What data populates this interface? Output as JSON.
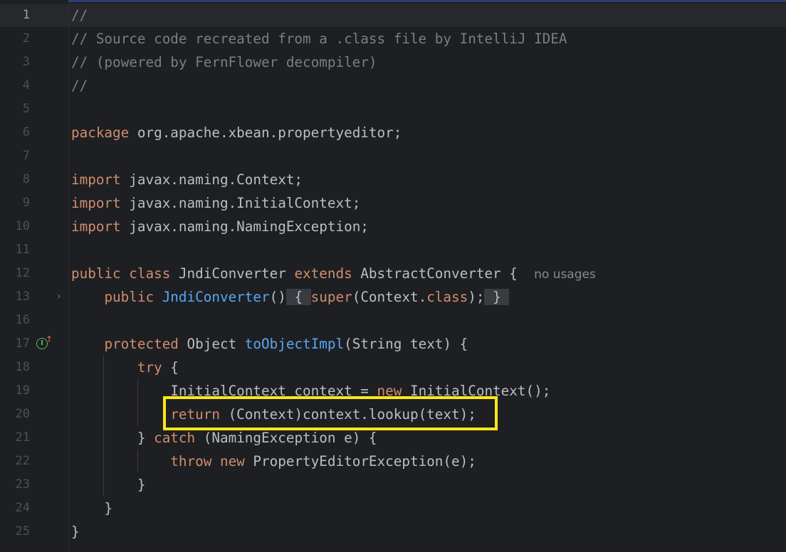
{
  "editor": {
    "lines": [
      {
        "num": "1",
        "text": "//"
      },
      {
        "num": "2",
        "text": "// Source code recreated from a .class file by IntelliJ IDEA"
      },
      {
        "num": "3",
        "text": "// (powered by FernFlower decompiler)"
      },
      {
        "num": "4",
        "text": "//"
      },
      {
        "num": "5",
        "text": ""
      },
      {
        "num": "6",
        "kw": "package",
        "rest": " org.apache.xbean.propertyeditor;"
      },
      {
        "num": "7",
        "text": ""
      },
      {
        "num": "8",
        "kw": "import",
        "rest": " javax.naming.Context;"
      },
      {
        "num": "9",
        "kw": "import",
        "rest": " javax.naming.InitialContext;"
      },
      {
        "num": "10",
        "kw": "import",
        "rest": " javax.naming.NamingException;"
      },
      {
        "num": "11",
        "text": ""
      },
      {
        "num": "12",
        "kw1": "public",
        "kw2": "class",
        "name": " JndiConverter ",
        "kw3": "extends",
        "rest": " AbstractConverter {",
        "hint": "no usages"
      },
      {
        "num": "13",
        "kw": "public",
        "fn": "JndiConverter",
        "parens": "()",
        "brace_open": "{",
        "kw_super": "super",
        "args": "(Context.",
        "kw_class": "class",
        "end": ");",
        "brace_close": "}"
      },
      {
        "num": "16",
        "text": ""
      },
      {
        "num": "17",
        "kw": "protected",
        "type": " Object ",
        "fn": "toObjectImpl",
        "rest": "(String text) {"
      },
      {
        "num": "18",
        "kw": "try",
        "rest": " {"
      },
      {
        "num": "19",
        "pre": "InitialContext context = ",
        "kw": "new",
        "rest": " InitialContext();"
      },
      {
        "num": "20",
        "kw": "return",
        "rest": " (Context)context.lookup(text);"
      },
      {
        "num": "21",
        "pre": "} ",
        "kw": "catch",
        "rest": " (NamingException e) {"
      },
      {
        "num": "22",
        "kw1": "throw",
        "kw2": "new",
        "rest": " PropertyEditorException(e);"
      },
      {
        "num": "23",
        "text": "}"
      },
      {
        "num": "24",
        "text": "}"
      },
      {
        "num": "25",
        "text": "}"
      }
    ],
    "highlight_color": "#ffe816"
  }
}
